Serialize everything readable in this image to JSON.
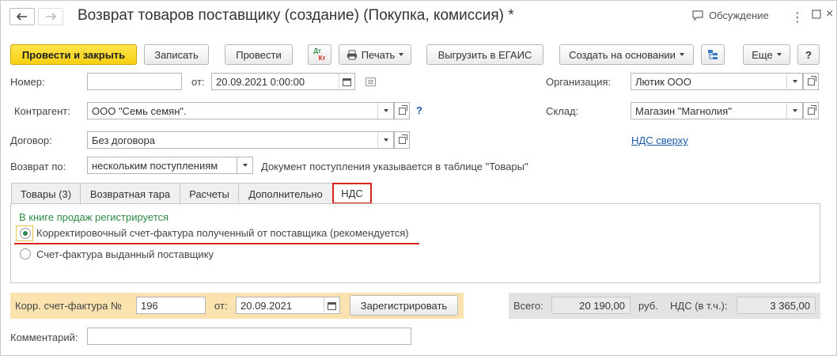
{
  "window": {
    "title": "Возврат товаров поставщику (создание) (Покупка, комиссия) *",
    "discussion_label": "Обсуждение"
  },
  "toolbar": {
    "post_close": "Провести и закрыть",
    "save": "Записать",
    "post": "Провести",
    "dt_kt_top": "Дт",
    "dt_kt_bottom": "Кт",
    "print": "Печать",
    "egais": "Выгрузить в ЕГАИС",
    "create_based": "Создать на основании",
    "more": "Еще",
    "help": "?"
  },
  "form": {
    "number_label": "Номер:",
    "number_value": "",
    "from_label": "от:",
    "date_value": "20.09.2021  0:00:00",
    "org_label": "Организация:",
    "org_value": "Лютик ООО",
    "contractor_label": "Контрагент:",
    "contractor_value": "ООО \"Семь семян\".",
    "help_q": "?",
    "warehouse_label": "Склад:",
    "warehouse_value": "Магазин \"Магнолия\"",
    "contract_label": "Договор:",
    "contract_value": "Без договора",
    "vat_link": "НДС сверху",
    "return_by_label": "Возврат по:",
    "return_by_value": "нескольким поступлениям",
    "return_hint": "Документ поступления указывается в таблице \"Товары\""
  },
  "tabs": [
    {
      "label": "Товары (3)"
    },
    {
      "label": "Возвратная тара"
    },
    {
      "label": "Расчеты"
    },
    {
      "label": "Дополнительно"
    },
    {
      "label": "НДС"
    }
  ],
  "vat_panel": {
    "heading": "В книге продаж регистрируется",
    "option1": "Корректировочный счет-фактура полученный от поставщика (рекомендуется)",
    "option2": "Счет-фактура выданный поставщику",
    "selected": 1
  },
  "bottom": {
    "corr_label": "Корр. счет-фактура №",
    "corr_number": "196",
    "from_label": "от:",
    "corr_date": "20.09.2021",
    "register_btn": "Зарегистрировать",
    "total_label": "Всего:",
    "total_value": "20 190,00",
    "currency": "руб.",
    "vat_label": "НДС (в т.ч.):",
    "vat_value": "3 365,00",
    "comment_label": "Комментарий:",
    "comment_value": ""
  },
  "colors": {
    "primary_button": "#f7cf14",
    "highlight_red": "#d9241c",
    "green_text": "#2e8b46",
    "link": "#1a5aa8"
  }
}
